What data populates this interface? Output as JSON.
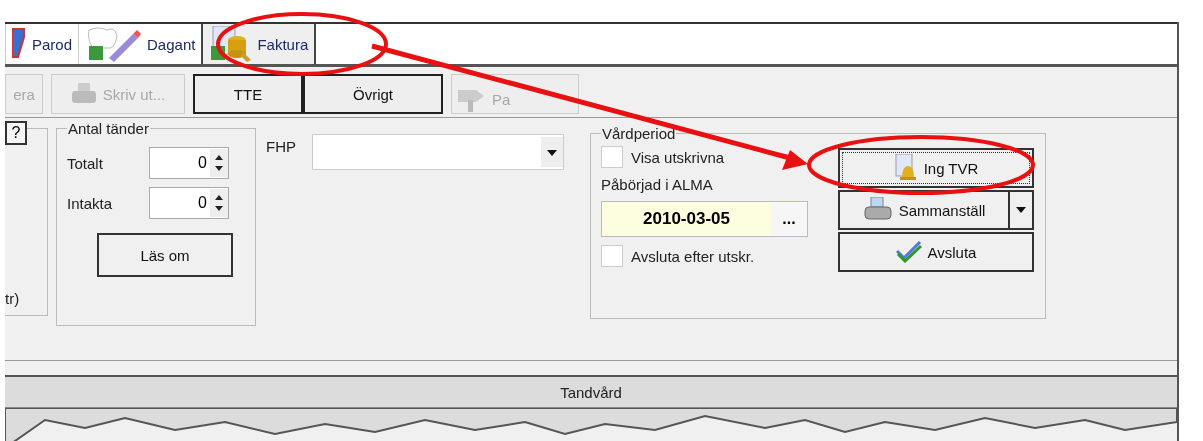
{
  "ribbon_tabs": [
    {
      "label": "Parod",
      "kind": "ruler",
      "selected": false
    },
    {
      "label": "Dagant",
      "kind": "tooth",
      "selected": false
    },
    {
      "label": "Faktura",
      "kind": "coins",
      "selected": true
    }
  ],
  "toolbar_buttons": [
    {
      "label": "era",
      "kind": "plain",
      "disabled": true
    },
    {
      "label": "Skriv ut...",
      "kind": "printer",
      "disabled": true
    },
    {
      "label": "TTE",
      "kind": "plain",
      "disabled": false
    },
    {
      "label": "Övrigt",
      "kind": "plain",
      "disabled": false
    },
    {
      "label": "Pa",
      "kind": "signpost",
      "disabled": true
    }
  ],
  "left_group": {
    "help_button": "?",
    "text": "tr)"
  },
  "teeth_group": {
    "title": "Antal tänder",
    "fields": [
      {
        "label": "Totalt",
        "value": "0"
      },
      {
        "label": "Intakta",
        "value": "0"
      }
    ],
    "button": "Läs om"
  },
  "fhp": {
    "label": "FHP"
  },
  "care_period": {
    "title": "Vårdperiod",
    "show_printed": {
      "label": "Visa utskrivna",
      "checked": false
    },
    "started_label": "Påbörjad i ALMA",
    "started_date": "2010-03-05",
    "date_button": "...",
    "close_after": {
      "label": "Avsluta efter utskr.",
      "checked": false
    }
  },
  "actions": [
    {
      "label": "Ing TVR",
      "kind": "bell",
      "focused": true
    },
    {
      "label": "Sammanställ",
      "kind": "split",
      "focused": false
    },
    {
      "label": "Avsluta",
      "kind": "check",
      "focused": false
    }
  ],
  "status_bar": {
    "label": "Tandvård"
  }
}
